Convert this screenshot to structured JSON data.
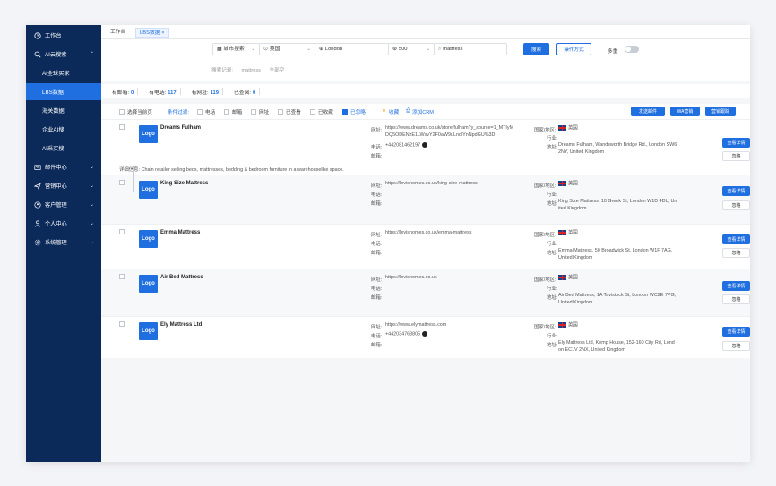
{
  "sidebar": {
    "items": [
      {
        "label": "工作台",
        "icon": "clock-icon",
        "chevron": ""
      },
      {
        "label": "AI云搜索",
        "icon": "search-icon",
        "chevron": "⌃"
      },
      {
        "label": "AI全球买家",
        "icon": "",
        "chevron": ""
      },
      {
        "label": "LBS数据",
        "icon": "",
        "chevron": ""
      },
      {
        "label": "海关数据",
        "icon": "",
        "chevron": ""
      },
      {
        "label": "企业AI搜",
        "icon": "",
        "chevron": ""
      },
      {
        "label": "AI采买搜",
        "icon": "",
        "chevron": ""
      },
      {
        "label": "邮件中心",
        "icon": "mail-icon",
        "chevron": "⌄"
      },
      {
        "label": "营销中心",
        "icon": "send-icon",
        "chevron": "⌄"
      },
      {
        "label": "客户管理",
        "icon": "customer-icon",
        "chevron": "⌄"
      },
      {
        "label": "个人中心",
        "icon": "person-icon",
        "chevron": "⌄"
      },
      {
        "label": "系统管理",
        "icon": "settings-icon",
        "chevron": "⌄"
      }
    ]
  },
  "tabs": [
    {
      "label": "工作台"
    },
    {
      "label": "LBS数据 ×"
    }
  ],
  "search": {
    "mode": "城市搜索",
    "country": "英国",
    "city": "London",
    "radius": "500",
    "keyword": "mattress",
    "search_btn": "搜索",
    "help_btn": "操作方式",
    "multi_label": "多重",
    "history_label": "搜索记录:",
    "history_item": "mattress",
    "history_clear": "全部空"
  },
  "stats": [
    {
      "label": "有邮箱:",
      "value": "0"
    },
    {
      "label": "有电话:",
      "value": "117"
    },
    {
      "label": "有网址:",
      "value": "119"
    },
    {
      "label": "已查阅:",
      "value": "0"
    }
  ],
  "filters": {
    "select_page": "选择当前页",
    "filter_label": "条件过滤:",
    "phone": "电话",
    "email": "邮箱",
    "website": "网址",
    "viewed": "已查看",
    "collected": "已收藏",
    "ignored": "已忽略",
    "favorite": "收藏",
    "add_crm": "添加CRM",
    "send_email": "发送邮件",
    "wa_marketing": "WA营销",
    "marketing_track": "营销跟踪"
  },
  "labels": {
    "website": "网址:",
    "phone": "电话:",
    "email": "邮箱:",
    "region": "国家/地区:",
    "industry": "行业:",
    "address": "地址:",
    "view_detail": "查看详情",
    "ignore": "忽略",
    "logo": "Logo",
    "detail_label": "详细信息:"
  },
  "results": [
    {
      "name": "Dreams Fulham",
      "website": "https://www.dreams.co.uk/store/fulham?y_source=1_MTIyMDQ5ODENzE1LWxvY2F0aW9uLndlYnNpdGU%3D",
      "website_line1": "https://www.dreams.co.uk/store/fulham?y_source=1_MTIyM",
      "website_line2": "DQ5ODENzE1LWxvY2F0aW9uLndlYnNpdGU%3D",
      "phone": "+442081462197",
      "email": "",
      "region": "英国",
      "industry": "",
      "address_line1": "Dreams Fulham, Wandsworth Bridge Rd., London SW6",
      "address_line2": "2NY, United Kingdom",
      "detail": "Chain retailer selling beds, mattresses, bedding & bedroom furniture in a warehouselike space."
    },
    {
      "name": "King Size Mattress",
      "website": "https://levishomes.co.uk/king-size-mattress",
      "phone": "",
      "email": "",
      "region": "英国",
      "industry": "",
      "address_line1": "King Size Mattress, 10 Greek St, London W1D 4DL, Un",
      "address_line2": "ited Kingdom"
    },
    {
      "name": "Emma Mattress",
      "website": "https://levishomes.co.uk/emma-mattress",
      "phone": "",
      "email": "",
      "region": "英国",
      "industry": "",
      "address_line1": "Emma Mattress, 50 Broadwick St, London W1F 7AG,",
      "address_line2": "United Kingdom"
    },
    {
      "name": "Air Bed Mattress",
      "website": "https://levishomes.co.uk",
      "phone": "",
      "email": "",
      "region": "英国",
      "industry": "",
      "address_line1": "Air Bed Mattress, 1A Tavistock St, London WC2E 7PG,",
      "address_line2": "United Kingdom"
    },
    {
      "name": "Ely Mattress Ltd",
      "website": "https://www.elymattress.com",
      "phone": "+442034763805",
      "email": "",
      "region": "英国",
      "industry": "",
      "address_line1": "Ely Mattress Ltd, Kemp House, 152-160 City Rd, Lond",
      "address_line2": "on EC1V 2NX, United Kingdom"
    }
  ],
  "colors": {
    "sidebar_bg": "#0b2a5a",
    "accent": "#1f6fe0"
  }
}
